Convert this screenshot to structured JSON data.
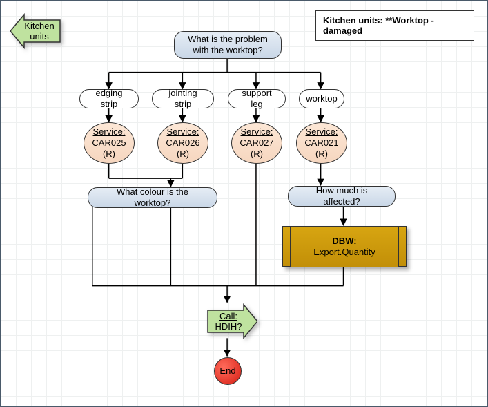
{
  "title": "Kitchen units: **Worktop - damaged",
  "back_label": "Kitchen units",
  "q_main": "What is the problem with the worktop?",
  "options": {
    "edging": "edging strip",
    "jointing": "jointing strip",
    "support": "support leg",
    "worktop": "worktop"
  },
  "services": {
    "header": "Service:",
    "edging": {
      "code": "CAR025",
      "suffix": "(R)"
    },
    "jointing": {
      "code": "CAR026",
      "suffix": "(R)"
    },
    "support": {
      "code": "CAR027",
      "suffix": "(R)"
    },
    "worktop": {
      "code": "CAR021",
      "suffix": "(R)"
    }
  },
  "q_colour": "What colour is the worktop?",
  "q_amount": "How much is affected?",
  "dbw": {
    "header": "DBW:",
    "text": "Export.Quantity"
  },
  "call": {
    "header": "Call:",
    "text": "HDIH?"
  },
  "end": "End"
}
